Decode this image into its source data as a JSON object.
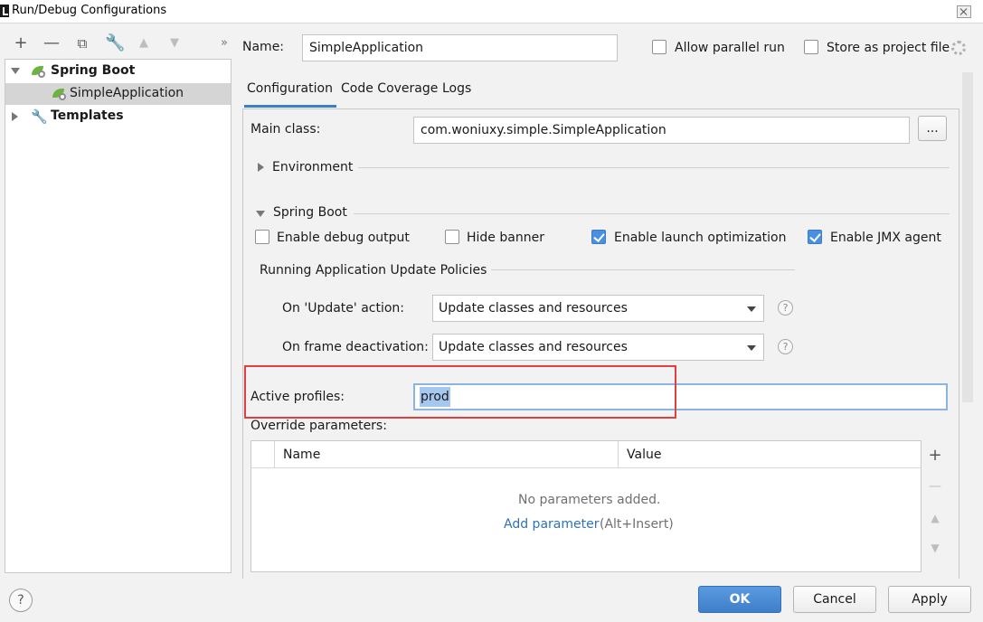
{
  "window": {
    "title": "Run/Debug Configurations"
  },
  "toolbar": {
    "icons": [
      "plus-icon",
      "minus-icon",
      "copy-icon",
      "wrench-icon",
      "arrow-up-icon",
      "arrow-down-icon",
      "more-icon"
    ]
  },
  "tree": {
    "spring_boot": "Spring Boot",
    "simple_application": "SimpleApplication",
    "templates": "Templates"
  },
  "header": {
    "name_label": "Name:",
    "name_value": "SimpleApplication",
    "allow_parallel_run": "Allow parallel run",
    "allow_parallel_run_checked": false,
    "store_as_project_file": "Store as project file",
    "store_as_project_file_checked": false
  },
  "tabs": [
    {
      "label": "Configuration",
      "active": true
    },
    {
      "label": "Code Coverage",
      "active": false
    },
    {
      "label": "Logs",
      "active": false
    }
  ],
  "config": {
    "main_class_label": "Main class:",
    "main_class_value": "com.woniuxy.simple.SimpleApplication",
    "browse_label": "...",
    "environment_label": "Environment",
    "spring_boot_section": "Spring Boot",
    "enable_debug_output": "Enable debug output",
    "enable_debug_output_checked": false,
    "hide_banner": "Hide banner",
    "hide_banner_checked": false,
    "enable_launch_optimization": "Enable launch optimization",
    "enable_launch_optimization_checked": true,
    "enable_jmx_agent": "Enable JMX agent",
    "enable_jmx_agent_checked": true,
    "update_policies_label": "Running Application Update Policies",
    "on_update_label": "On 'Update' action:",
    "on_update_value": "Update classes and resources",
    "on_frame_label": "On frame deactivation:",
    "on_frame_value": "Update classes and resources",
    "help_mark": "?",
    "active_profiles_label": "Active profiles:",
    "active_profiles_value": "prod",
    "override_parameters_label": "Override parameters:",
    "table": {
      "columns": [
        "Name",
        "Value"
      ],
      "empty_text": "No parameters added.",
      "add_link": "Add parameter",
      "add_shortcut": "(Alt+Insert)"
    }
  },
  "footer": {
    "help_mark": "?",
    "ok": "OK",
    "cancel": "Cancel",
    "apply": "Apply"
  },
  "colors": {
    "accent": "#3b80c6",
    "checkbox_checked": "#4a90e2",
    "highlight_box": "#e0403f",
    "spring_green": "#6db33f"
  }
}
